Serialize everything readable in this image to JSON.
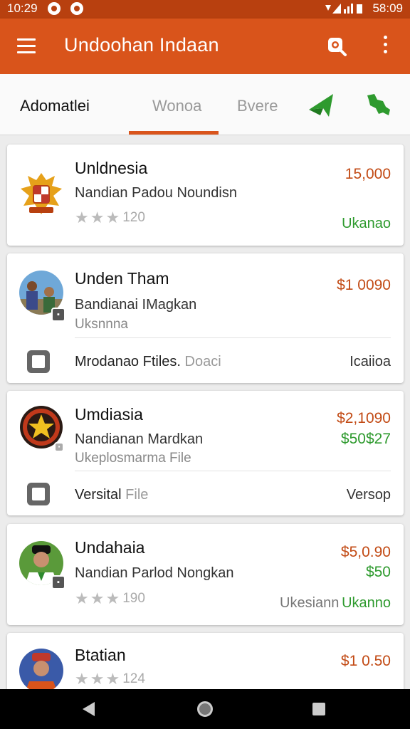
{
  "status_bar": {
    "time_left": "10:29",
    "time_right": "58:09"
  },
  "app_bar": {
    "title": "Undoohan Indaan",
    "menu_icon": "menu-icon",
    "search_icon": "search-icon",
    "more_icon": "more-vert-icon"
  },
  "tabs": [
    {
      "label": "Adomatlei",
      "active": true
    },
    {
      "label": "Wonoa",
      "active": false
    },
    {
      "label": "Bvere",
      "active": false
    }
  ],
  "tab_icons": [
    "plane-icon",
    "map-icon"
  ],
  "cards": [
    {
      "title": "Unldnesia",
      "subtitle": "Nandian Padou Noundisn",
      "rating_count": "120",
      "price": "15,000",
      "status": "Ukanao",
      "avatar": "emblem-icon"
    },
    {
      "title": "Unden Tham",
      "subtitle": "Bandianai IMagkan",
      "subtitle2": "Uksnnna",
      "price": "$1 0090",
      "avatar": "people-photo",
      "file_label": "Mrodanao Ftiles.",
      "file_label_muted": "Doaci",
      "file_right": "Icaiioa"
    },
    {
      "title": "Umdiasia",
      "subtitle": "Nandianan Mardkan",
      "subtitle2": "Ukeplosmarma File",
      "price": "$2,1090",
      "price2": "$50$27",
      "avatar": "star-badge-icon",
      "file_label": "Versital",
      "file_label_muted": "File",
      "file_right": "Versop"
    },
    {
      "title": "Undahaia",
      "subtitle": "Nandian Parlod Nongkan",
      "rating_count": "190",
      "price": "$5,0.90",
      "price2": "$50",
      "status_grey": "Ukesiann",
      "status": "Ukanno",
      "avatar": "person-photo"
    },
    {
      "title": "Btatian",
      "rating_count": "124",
      "price": "$1 0.50",
      "avatar": "person-photo-2"
    }
  ],
  "nav": {
    "back_icon": "back-icon",
    "home_icon": "home-icon",
    "recent_icon": "recent-apps-icon"
  },
  "colors": {
    "app_bar": "#d9541b",
    "status_bar": "#b8400f",
    "price": "#c24a14",
    "positive": "#2e9a2e"
  }
}
